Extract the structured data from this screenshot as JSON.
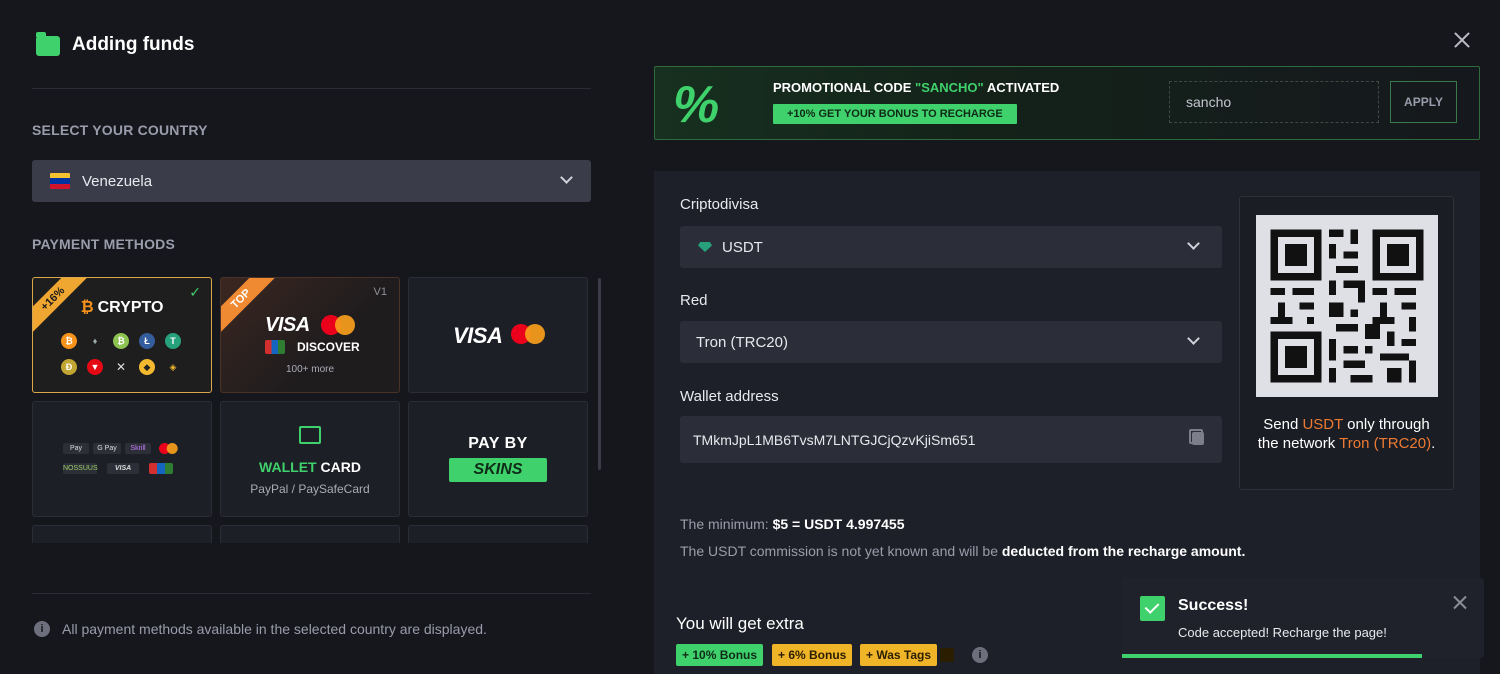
{
  "modal": {
    "title": "Adding funds",
    "close_icon": "close-icon"
  },
  "country": {
    "section_label": "SELECT YOUR COUNTRY",
    "selected": "Venezuela",
    "flag_colors": [
      "#f4c430",
      "#0033a0",
      "#cf142b"
    ]
  },
  "payment_methods": {
    "section_label": "PAYMENT METHODS",
    "cards": [
      {
        "id": "crypto",
        "label": "CRYPTO",
        "ribbon": "+16%",
        "selected": true
      },
      {
        "id": "visa-mc-discover",
        "ribbon": "TOP",
        "version": "V1",
        "visa": "VISA",
        "discover": "DISCOVER",
        "more": "100+ more"
      },
      {
        "id": "visa-mc",
        "visa": "VISA"
      },
      {
        "id": "wallets",
        "badges": [
          "Pay",
          "G Pay",
          "Skrill",
          "",
          "NOSSUUS",
          "VISA",
          ""
        ]
      },
      {
        "id": "wallet-card",
        "title_green": "WALLET",
        "title_white": " CARD",
        "subtitle": "PayPal / PaySafeCard"
      },
      {
        "id": "pay-by-skins",
        "line1": "PAY BY",
        "line2": "SKINS"
      }
    ],
    "footer_note": "All payment methods available in the selected country are displayed."
  },
  "promo": {
    "title_prefix": "PROMOTIONAL CODE ",
    "code_quoted": "\"SANCHO\"",
    "title_suffix": " ACTIVATED",
    "badge": "+10% GET YOUR BONUS TO RECHARGE",
    "input_value": "sancho",
    "apply_label": "APPLY",
    "percent_glyph": "%"
  },
  "form": {
    "currency_label": "Criptodivisa",
    "currency_value": "USDT",
    "network_label": "Red",
    "network_value": "Tron (TRC20)",
    "wallet_label": "Wallet address",
    "wallet_value": "TMkmJpL1MB6TvsM7LNTGJCjQzvKjiSm651"
  },
  "qr": {
    "note_1": "Send ",
    "note_currency": "USDT",
    "note_2": " only through the network ",
    "note_network": "Tron (TRC20)",
    "note_3": "."
  },
  "minimum": {
    "label": "The minimum: ",
    "value": "$5 = USDT 4.997455"
  },
  "commission": {
    "text": "The USDT commission is not yet known and will be ",
    "bold": "deducted from the recharge amount."
  },
  "extra": {
    "title": "You will get extra",
    "tags": [
      {
        "label": "+ 10% Bonus",
        "bg": "#3fd16b",
        "fg": "#0f2a17"
      },
      {
        "label": "+ 6% Bonus",
        "bg": "#f0b429",
        "fg": "#2a1d00"
      },
      {
        "label": "+ Was Tags",
        "bg": "#f0b429",
        "fg": "#2a1d00"
      }
    ]
  },
  "toast": {
    "title": "Success!",
    "message": "Code accepted! Recharge the page!",
    "progress": 0.83
  },
  "colors": {
    "accent_green": "#3fd16b",
    "accent_orange": "#ec7a32",
    "background": "#16171d"
  }
}
